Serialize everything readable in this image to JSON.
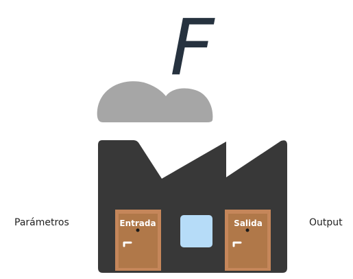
{
  "function_symbol": "F",
  "input_label": "Parámetros",
  "output_label": "Output",
  "doors": {
    "entrance": "Entrada",
    "exit": "Salida"
  },
  "colors": {
    "factory": "#383838",
    "cloud": "#a6a6a6",
    "door_frame": "#c5865a",
    "door_panel": "#b07849",
    "window": "#b6dcf8",
    "symbol": "#26323f"
  }
}
